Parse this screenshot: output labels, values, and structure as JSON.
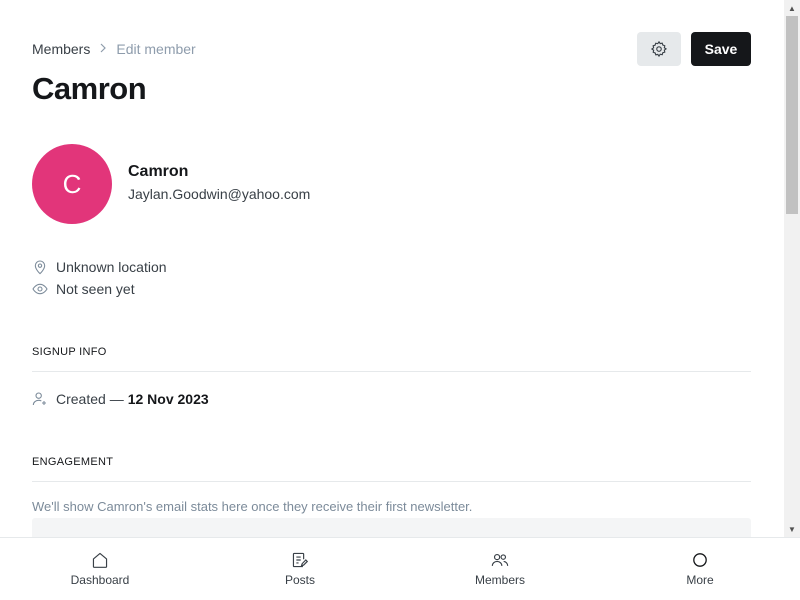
{
  "breadcrumb": {
    "parent": "Members",
    "separator": ">",
    "current": "Edit member"
  },
  "header": {
    "title": "Camron",
    "save_label": "Save"
  },
  "member": {
    "initial": "C",
    "name": "Camron",
    "email": "Jaylan.Goodwin@yahoo.com",
    "avatar_color": "#e2357a",
    "location": "Unknown location",
    "last_seen": "Not seen yet"
  },
  "signup": {
    "section_title": "SIGNUP INFO",
    "created_label": "Created —",
    "created_date": "12 Nov 2023"
  },
  "engagement": {
    "section_title": "ENGAGEMENT",
    "message": "We'll show Camron's email stats here once they receive their first newsletter."
  },
  "bottom_nav": {
    "dashboard": "Dashboard",
    "posts": "Posts",
    "members": "Members",
    "more": "More"
  },
  "icons": [
    "gear-icon",
    "location-pin-icon",
    "eye-icon",
    "user-plus-icon",
    "home-icon",
    "posts-icon",
    "members-icon",
    "more-icon"
  ]
}
